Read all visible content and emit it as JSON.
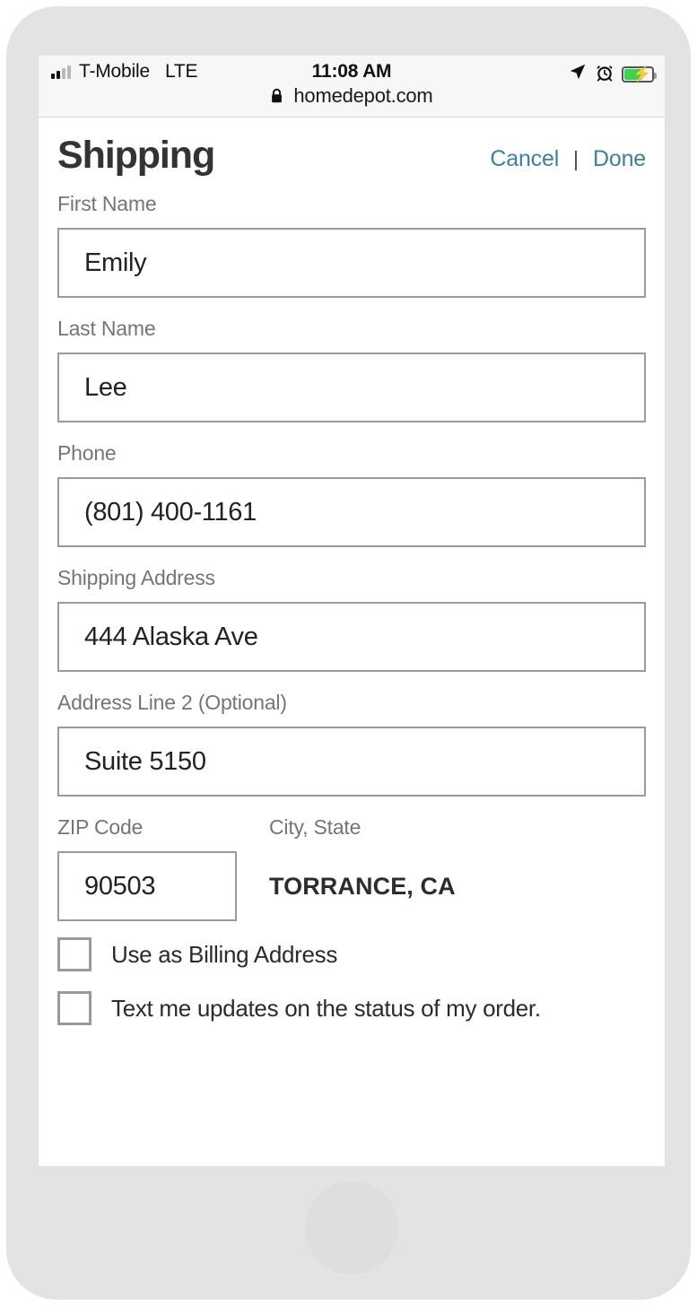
{
  "status_bar": {
    "carrier": "T-Mobile",
    "network": "LTE",
    "time": "11:08 AM",
    "signal_icon": "signal-bars-icon",
    "location_icon": "location-arrow-icon",
    "alarm_icon": "alarm-clock-icon",
    "battery_icon": "battery-charging-icon",
    "battery_color": "#3ed34f"
  },
  "browser": {
    "lock_icon": "lock-icon",
    "url": "homedepot.com"
  },
  "header": {
    "title": "Shipping",
    "cancel_label": "Cancel",
    "separator": "|",
    "done_label": "Done",
    "link_color": "#3c7fa6"
  },
  "form": {
    "fields": [
      {
        "label": "First Name",
        "value": "Emily"
      },
      {
        "label": "Last Name",
        "value": "Lee"
      },
      {
        "label": "Phone",
        "value": "(801) 400-1161"
      },
      {
        "label": "Shipping Address",
        "value": "444 Alaska Ave"
      },
      {
        "label": "Address Line 2 (Optional)",
        "value": "Suite 5150"
      }
    ],
    "zip": {
      "label": "ZIP Code",
      "value": "90503"
    },
    "city_state": {
      "label": "City, State",
      "value": "TORRANCE, CA"
    },
    "checkboxes": [
      {
        "label": "Use as Billing Address",
        "checked": false
      },
      {
        "label": "Text me updates on the status of my order.",
        "checked": false
      }
    ]
  }
}
